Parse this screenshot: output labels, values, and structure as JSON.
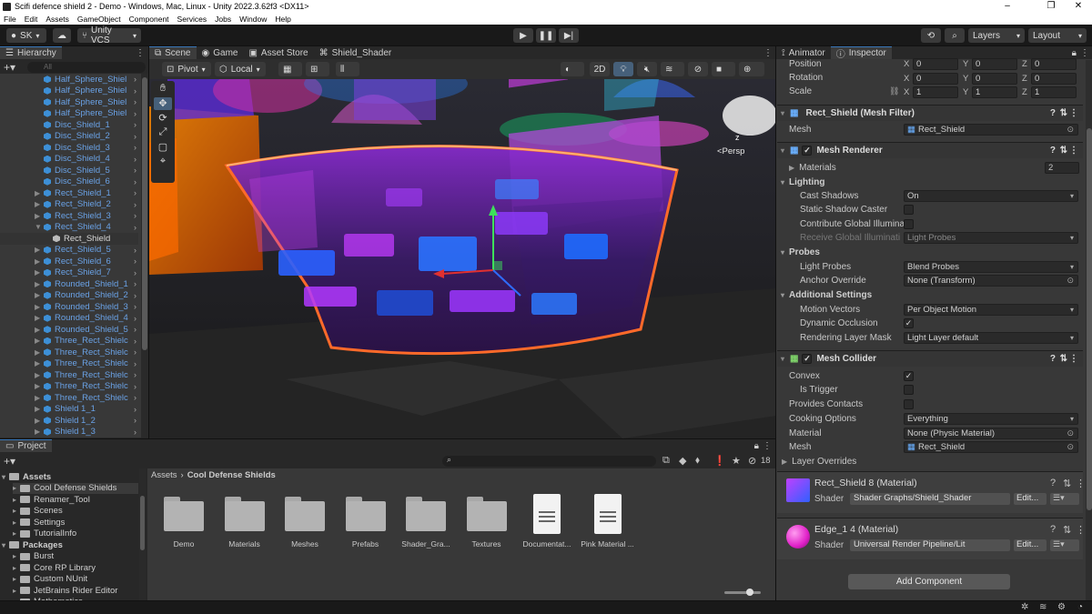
{
  "window": {
    "title": "Scifi defence shield 2 - Demo - Windows, Mac, Linux - Unity 2022.3.62f3 <DX11>"
  },
  "menu": [
    "File",
    "Edit",
    "Assets",
    "GameObject",
    "Component",
    "Services",
    "Jobs",
    "Window",
    "Help"
  ],
  "toolbar": {
    "account": "SK",
    "vcs": "Unity VCS",
    "layers": "Layers",
    "layout": "Layout"
  },
  "hierarchy": {
    "tab": "Hierarchy",
    "search_placeholder": "All",
    "items": [
      {
        "label": "Half_Sphere_Shiel",
        "arrow": ""
      },
      {
        "label": "Half_Sphere_Shiel",
        "arrow": ""
      },
      {
        "label": "Half_Sphere_Shiel",
        "arrow": ""
      },
      {
        "label": "Half_Sphere_Shiel",
        "arrow": ""
      },
      {
        "label": "Disc_Shield_1",
        "arrow": ""
      },
      {
        "label": "Disc_Shield_2",
        "arrow": ""
      },
      {
        "label": "Disc_Shield_3",
        "arrow": ""
      },
      {
        "label": "Disc_Shield_4",
        "arrow": ""
      },
      {
        "label": "Disc_Shield_5",
        "arrow": ""
      },
      {
        "label": "Disc_Shield_6",
        "arrow": ""
      },
      {
        "label": "Rect_Shield_1",
        "arrow": "▶"
      },
      {
        "label": "Rect_Shield_2",
        "arrow": "▶"
      },
      {
        "label": "Rect_Shield_3",
        "arrow": "▶"
      },
      {
        "label": "Rect_Shield_4",
        "arrow": "▼"
      },
      {
        "label": "Rect_Shield",
        "arrow": "",
        "child": true
      },
      {
        "label": "Rect_Shield_5",
        "arrow": "▶"
      },
      {
        "label": "Rect_Shield_6",
        "arrow": "▶"
      },
      {
        "label": "Rect_Shield_7",
        "arrow": "▶"
      },
      {
        "label": "Rounded_Shield_1",
        "arrow": "▶"
      },
      {
        "label": "Rounded_Shield_2",
        "arrow": "▶"
      },
      {
        "label": "Rounded_Shield_3",
        "arrow": "▶"
      },
      {
        "label": "Rounded_Shield_4",
        "arrow": "▶"
      },
      {
        "label": "Rounded_Shield_5",
        "arrow": "▶"
      },
      {
        "label": "Three_Rect_Shielc",
        "arrow": "▶"
      },
      {
        "label": "Three_Rect_Shielc",
        "arrow": "▶"
      },
      {
        "label": "Three_Rect_Shielc",
        "arrow": "▶"
      },
      {
        "label": "Three_Rect_Shielc",
        "arrow": "▶"
      },
      {
        "label": "Three_Rect_Shielc",
        "arrow": "▶"
      },
      {
        "label": "Three_Rect_Shielc",
        "arrow": "▶"
      },
      {
        "label": "Shield 1_1",
        "arrow": "▶"
      },
      {
        "label": "Shield 1_2",
        "arrow": "▶"
      },
      {
        "label": "Shield 1_3",
        "arrow": "▶"
      }
    ]
  },
  "scene": {
    "tabs": [
      "Scene",
      "Game",
      "Asset Store",
      "Shield_Shader"
    ],
    "pivot": "Pivot",
    "local": "Local",
    "mode_2d": "2D",
    "persp": "<Persp",
    "gizmo_axis_z": "z"
  },
  "project": {
    "tab": "Project",
    "breadcrumb": [
      "Assets",
      "Cool Defense Shields"
    ],
    "count": "18",
    "tree": [
      {
        "label": "Assets",
        "bold": true,
        "depth": 0
      },
      {
        "label": "Cool Defense Shields",
        "depth": 1,
        "selected": true
      },
      {
        "label": "Renamer_Tool",
        "depth": 1
      },
      {
        "label": "Scenes",
        "depth": 1
      },
      {
        "label": "Settings",
        "depth": 1
      },
      {
        "label": "TutorialInfo",
        "depth": 1
      },
      {
        "label": "Packages",
        "bold": true,
        "depth": 0
      },
      {
        "label": "Burst",
        "depth": 1
      },
      {
        "label": "Core RP Library",
        "depth": 1
      },
      {
        "label": "Custom NUnit",
        "depth": 1
      },
      {
        "label": "JetBrains Rider Editor",
        "depth": 1
      },
      {
        "label": "Mathematics",
        "depth": 1
      }
    ],
    "assets": [
      {
        "label": "Demo",
        "kind": "folder"
      },
      {
        "label": "Materials",
        "kind": "folder"
      },
      {
        "label": "Meshes",
        "kind": "folder"
      },
      {
        "label": "Prefabs",
        "kind": "folder"
      },
      {
        "label": "Shader_Gra...",
        "kind": "folder"
      },
      {
        "label": "Textures",
        "kind": "folder"
      },
      {
        "label": "Documentat...",
        "kind": "doc"
      },
      {
        "label": "Pink Material ...",
        "kind": "doc"
      }
    ]
  },
  "inspector": {
    "tabs": [
      "Animator",
      "Inspector"
    ],
    "transform": {
      "position": {
        "label": "Position",
        "x": "0",
        "y": "0",
        "z": "0"
      },
      "rotation": {
        "label": "Rotation",
        "x": "0",
        "y": "0",
        "z": "0"
      },
      "scale": {
        "label": "Scale",
        "x": "1",
        "y": "1",
        "z": "1"
      }
    },
    "mesh_filter": {
      "title": "Rect_Shield (Mesh Filter)",
      "mesh_label": "Mesh",
      "mesh": "Rect_Shield"
    },
    "mesh_renderer": {
      "title": "Mesh Renderer",
      "materials_label": "Materials",
      "materials_count": "2",
      "lighting": "Lighting",
      "cast_shadows_label": "Cast Shadows",
      "cast_shadows": "On",
      "static_shadow_label": "Static Shadow Caster",
      "contribute_gi_label": "Contribute Global Illumina",
      "receive_gi_label": "Receive Global Illuminati",
      "receive_gi": "Light Probes",
      "probes": "Probes",
      "light_probes_label": "Light Probes",
      "light_probes": "Blend Probes",
      "anchor_label": "Anchor Override",
      "anchor": "None (Transform)",
      "additional": "Additional Settings",
      "motion_label": "Motion Vectors",
      "motion": "Per Object Motion",
      "occlusion_label": "Dynamic Occlusion",
      "layer_mask_label": "Rendering Layer Mask",
      "layer_mask": "Light Layer default"
    },
    "mesh_collider": {
      "title": "Mesh Collider",
      "convex_label": "Convex",
      "trigger_label": "Is Trigger",
      "contacts_label": "Provides Contacts",
      "cooking_label": "Cooking Options",
      "cooking": "Everything",
      "material_label": "Material",
      "material": "None (Physic Material)",
      "mesh_label": "Mesh",
      "mesh": "Rect_Shield",
      "layer_overrides": "Layer Overrides"
    },
    "materials": [
      {
        "name": "Rect_Shield 8 (Material)",
        "shader_label": "Shader",
        "shader": "Shader Graphs/Shield_Shader",
        "edit": "Edit..."
      },
      {
        "name": "Edge_1 4 (Material)",
        "shader_label": "Shader",
        "shader": "Universal Render Pipeline/Lit",
        "edit": "Edit..."
      }
    ],
    "add_component": "Add Component"
  },
  "colors": {
    "accent": "#3a79bb",
    "hierarchy_text": "#6aa2e6",
    "panel_bg": "#383838"
  }
}
